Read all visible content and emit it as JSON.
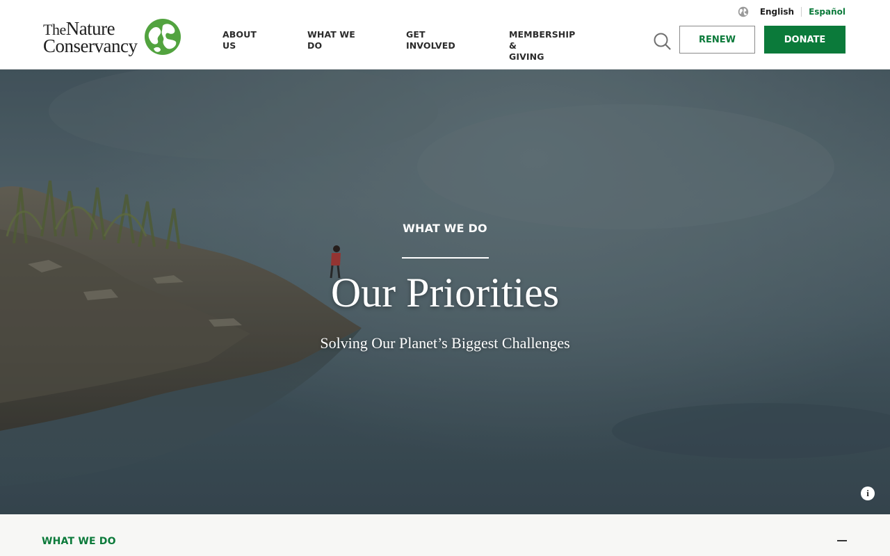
{
  "brand": {
    "logo_line1_prefix": "The",
    "logo_line1_main": "Nature",
    "logo_line2": "Conservancy",
    "accent_color": "#0b7a3a"
  },
  "language": {
    "icon": "globe-icon",
    "current": "English",
    "alternate": "Español"
  },
  "nav": {
    "items": [
      {
        "line1": "ABOUT",
        "line2": "US"
      },
      {
        "line1": "WHAT WE",
        "line2": "DO"
      },
      {
        "line1": "GET",
        "line2": "INVOLVED"
      },
      {
        "line1": "MEMBERSHIP &",
        "line2": "GIVING"
      }
    ]
  },
  "actions": {
    "search_icon": "search-icon",
    "renew_label": "RENEW",
    "donate_label": "DONATE"
  },
  "hero": {
    "eyebrow": "WHAT WE DO",
    "title": "Our Priorities",
    "subtitle": "Solving Our Planet’s Biggest Challenges",
    "info_label": "i"
  },
  "section": {
    "label": "WHAT WE DO",
    "toggle_icon": "minus-icon"
  }
}
